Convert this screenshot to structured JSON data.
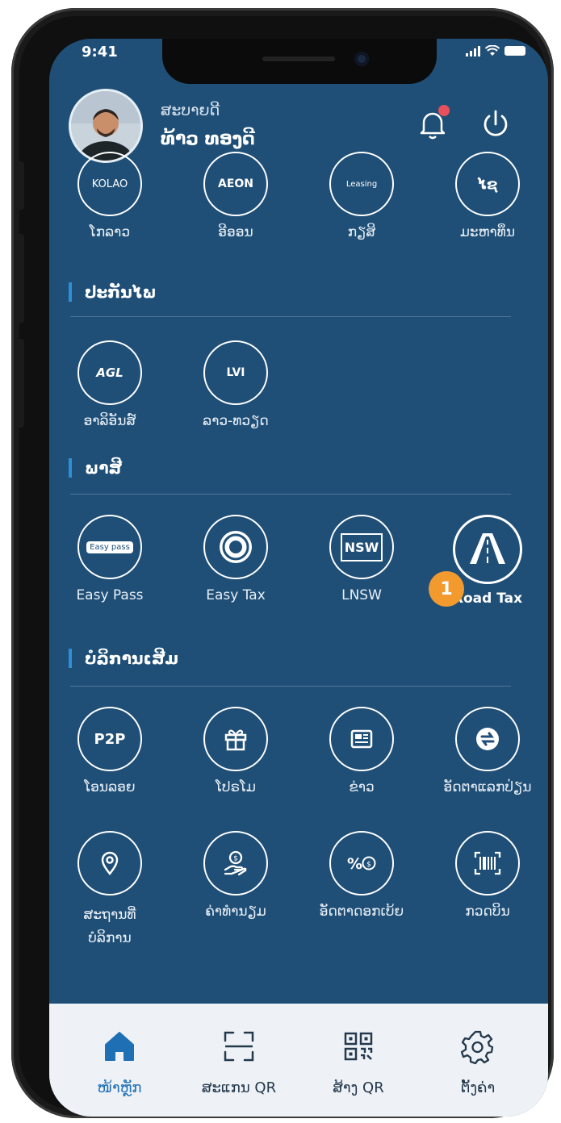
{
  "status_bar": {
    "time": "9:41"
  },
  "header": {
    "greeting": "ສະບາຍດີ",
    "username": "ທ້າວ ທອງດີ"
  },
  "partners_row": {
    "items": [
      {
        "label": "ໂກລາວ",
        "logo_text": "KOLAO"
      },
      {
        "label": "ອີອອນ",
        "logo_text": "AEON"
      },
      {
        "label": "ກຽສິ",
        "logo_text": "Leasing"
      },
      {
        "label": "ມະຫາທຶນ",
        "logo_text": "ໄຊ"
      }
    ]
  },
  "insurance": {
    "title": "ປະກັນໄພ",
    "items": [
      {
        "label": "ອາລິອັນສ໌",
        "logo_text": "AGL"
      },
      {
        "label": "ລາວ-ທວຽດ",
        "logo_text": "LVI"
      }
    ]
  },
  "tax": {
    "title": "ພາສີ",
    "items": [
      {
        "label": "Easy Pass",
        "logo_text": "Easy pass"
      },
      {
        "label": "Easy Tax",
        "logo_text": ""
      },
      {
        "label": "LNSW",
        "logo_text": "NSW"
      },
      {
        "label": "Road Tax",
        "logo_text": ""
      }
    ],
    "highlight_badge": "1"
  },
  "extra_services": {
    "title": "ບໍລິການເສີມ",
    "items": [
      {
        "label": "ໂອນລອຍ",
        "logo_text": "P2P"
      },
      {
        "label": "ໂປຣໂມ",
        "icon": "gift-icon"
      },
      {
        "label": "ຂ່າວ",
        "icon": "news-icon"
      },
      {
        "label": "ອັດຕາແລກປ່ຽນ",
        "icon": "exchange-icon"
      },
      {
        "label": "ສະຖານທີ່ບໍລິການ",
        "icon": "location-icon"
      },
      {
        "label": "ຄ່າທຳນຽມ",
        "icon": "fee-icon"
      },
      {
        "label": "ອັດຕາດອກເບ້ຍ",
        "icon": "interest-icon"
      },
      {
        "label": "ກວດບິນ",
        "icon": "barcode-icon"
      }
    ]
  },
  "bottom_nav": {
    "items": [
      {
        "label": "ໜ້າຫຼັກ",
        "active": true
      },
      {
        "label": "ສະແກນ QR",
        "active": false
      },
      {
        "label": "ສ້າງ QR",
        "active": false
      },
      {
        "label": "ຕັ້ງຄ່າ",
        "active": false
      }
    ]
  },
  "colors": {
    "screen_bg": "#1f4f77",
    "accent": "#2e8fd6",
    "badge": "#f29a2e",
    "nav_bg": "#eef2f6",
    "nav_active": "#1f6fb5"
  }
}
